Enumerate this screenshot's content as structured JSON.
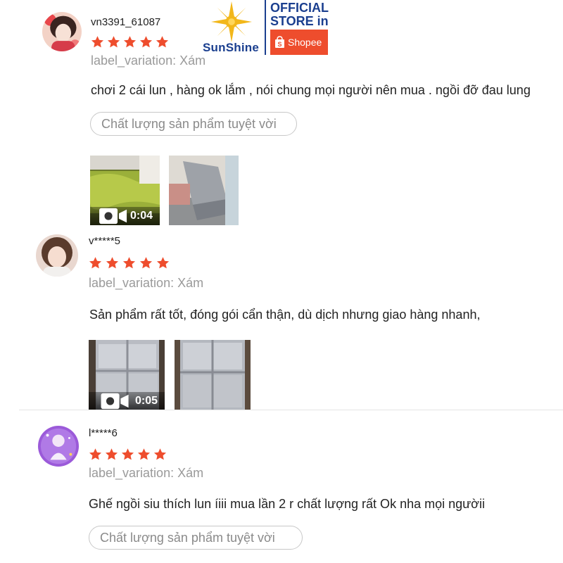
{
  "colors": {
    "star": "#ee4d2d",
    "brand_blue": "#1b3f8f",
    "shopee_orange": "#ee4d2d"
  },
  "logo": {
    "brand": "SunShine",
    "official_line1": "OFFICIAL",
    "official_line2": "STORE in",
    "shopee": "Shopee",
    "icon": "sun-icon"
  },
  "reviews": [
    {
      "username": "vn3391_61087",
      "rating": 5,
      "variation": "label_variation: Xám",
      "comment": "chơi 2 cái lun , hàng ok lắm , nói chung mọi người nên mua . ngồi đỡ đau lung",
      "tag": "Chất lượng sản phẩm tuyệt vời",
      "media": [
        {
          "type": "video",
          "duration": "0:04"
        },
        {
          "type": "image"
        }
      ]
    },
    {
      "username": "v*****5",
      "rating": 5,
      "variation": "label_variation: Xám",
      "comment": "Sản phẩm rất tốt, đóng gói cẩn thận, dù dịch nhưng giao hàng nhanh,",
      "media": [
        {
          "type": "video",
          "duration": "0:05"
        },
        {
          "type": "image"
        }
      ]
    },
    {
      "username": "l*****6",
      "rating": 5,
      "variation": "label_variation: Xám",
      "comment": "Ghế ngồi siu thích lun íiii mua lần 2 r chất lượng rất Ok nha mọi ngườii",
      "tag": "Chất lượng sản phẩm tuyệt vời"
    }
  ]
}
